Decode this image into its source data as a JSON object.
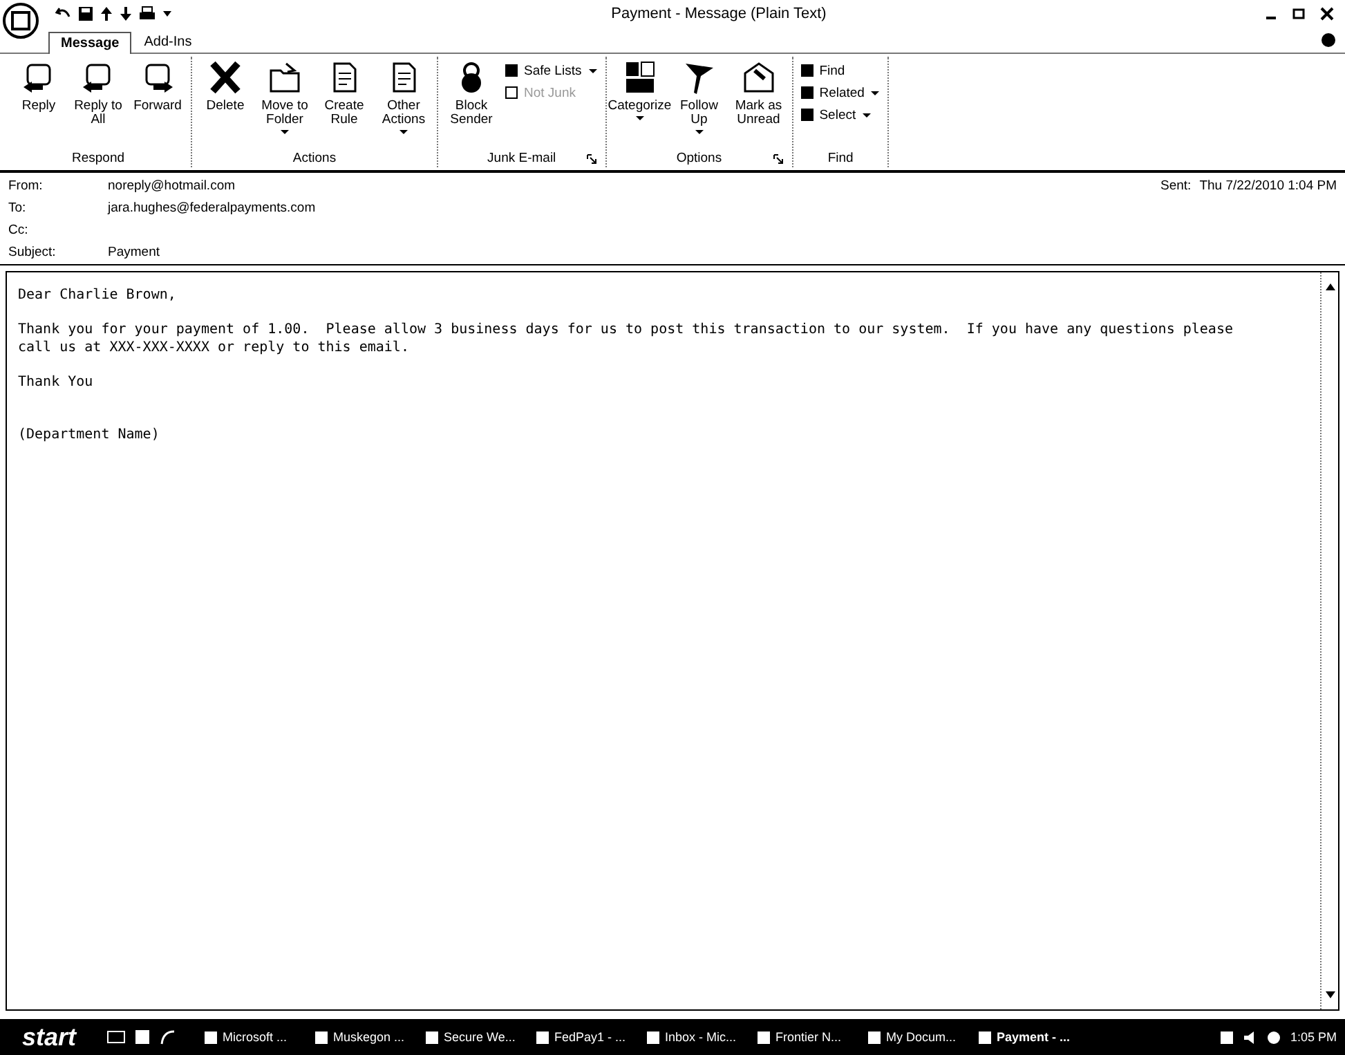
{
  "window": {
    "title": "Payment - Message (Plain Text)"
  },
  "tabs": [
    {
      "label": "Message",
      "selected": true
    },
    {
      "label": "Add-Ins",
      "selected": false
    }
  ],
  "ribbon": [
    {
      "name": "Respond",
      "launcher": false,
      "buttons": [
        {
          "kind": "large",
          "label": "Reply",
          "menu": false,
          "disabled": false
        },
        {
          "kind": "large",
          "label": "Reply to All",
          "menu": false,
          "disabled": false
        },
        {
          "kind": "large",
          "label": "Forward",
          "menu": false,
          "disabled": false
        }
      ]
    },
    {
      "name": "Actions",
      "launcher": false,
      "buttons": [
        {
          "kind": "large",
          "label": "Delete",
          "menu": false,
          "disabled": false
        },
        {
          "kind": "large",
          "label": "Move to Folder",
          "menu": true,
          "disabled": false
        },
        {
          "kind": "large",
          "label": "Create Rule",
          "menu": false,
          "disabled": false
        },
        {
          "kind": "large",
          "label": "Other Actions",
          "menu": true,
          "disabled": false
        }
      ]
    },
    {
      "name": "Junk E-mail",
      "launcher": true,
      "buttons": [
        {
          "kind": "large",
          "label": "Block Sender",
          "menu": false,
          "disabled": false
        },
        {
          "kind": "small",
          "label": "Safe Lists",
          "menu": true,
          "disabled": false
        },
        {
          "kind": "small",
          "label": "Not Junk",
          "menu": false,
          "disabled": true
        }
      ]
    },
    {
      "name": "Options",
      "launcher": true,
      "buttons": [
        {
          "kind": "large",
          "label": "Categorize",
          "menu": true,
          "disabled": false
        },
        {
          "kind": "large",
          "label": "Follow Up",
          "menu": true,
          "disabled": false
        },
        {
          "kind": "large",
          "label": "Mark as Unread",
          "menu": false,
          "disabled": false
        }
      ]
    },
    {
      "name": "Find",
      "launcher": false,
      "buttons": [
        {
          "kind": "small",
          "label": "Find",
          "menu": false,
          "disabled": false
        },
        {
          "kind": "small",
          "label": "Related",
          "menu": true,
          "disabled": false
        },
        {
          "kind": "small",
          "label": "Select",
          "menu": true,
          "disabled": false
        }
      ]
    }
  ],
  "header": {
    "fields": [
      {
        "label": "From:",
        "value": "noreply@hotmail.com"
      },
      {
        "label": "To:",
        "value": "jara.hughes@federalpayments.com"
      },
      {
        "label": "Cc:"
      },
      {
        "label": "Subject:",
        "value": "Payment"
      }
    ],
    "sent_label": "Sent:",
    "sent_value": "Thu 7/22/2010 1:04 PM"
  },
  "body": [
    "Dear Charlie Brown,",
    "Thank you for your payment of 1.00.  Please allow 3 business days for us to post this transaction to our system.  If you have any questions please call us at XXX-XXX-XXXX or reply to this email.",
    "Thank You",
    "(Department Name)"
  ],
  "taskbar": {
    "start": "start",
    "tasks": [
      {
        "label": "Microsoft ...",
        "selected": false
      },
      {
        "label": "Muskegon ...",
        "selected": false
      },
      {
        "label": "Secure We...",
        "selected": false
      },
      {
        "label": "FedPay1 - ...",
        "selected": false
      },
      {
        "label": "Inbox - Mic...",
        "selected": false
      },
      {
        "label": "Frontier N...",
        "selected": false
      },
      {
        "label": "My Docum...",
        "selected": false
      },
      {
        "label": "Payment - ...",
        "selected": true
      }
    ],
    "clock": "1:05 PM"
  }
}
